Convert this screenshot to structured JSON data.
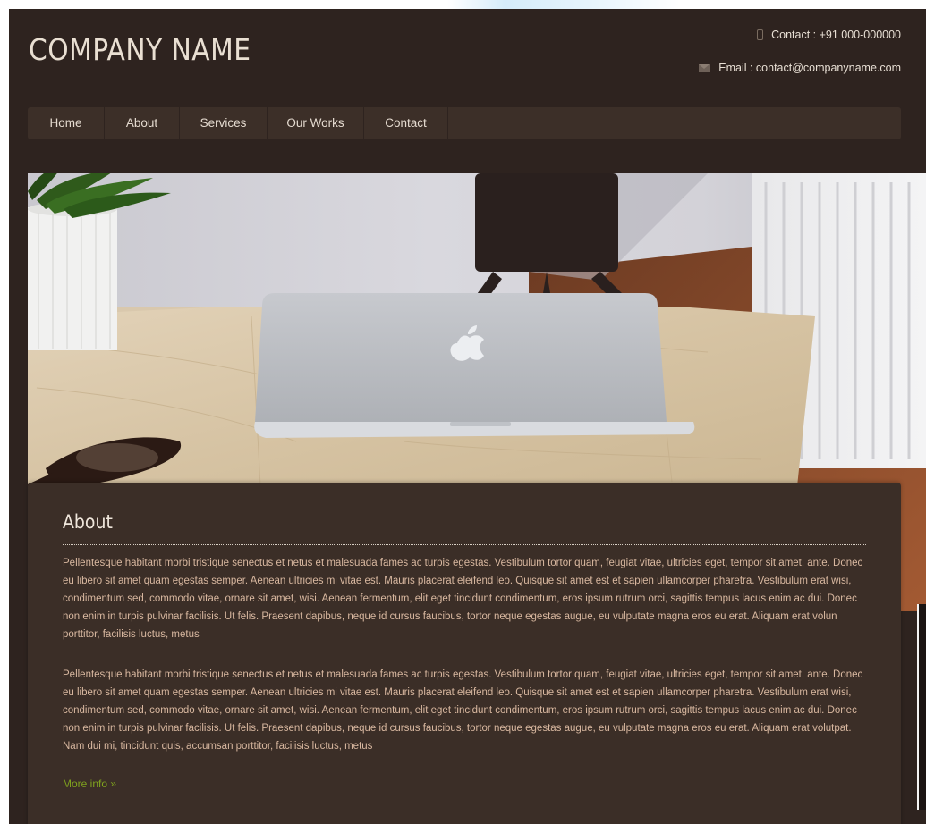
{
  "site": {
    "brand": "COMPANY NAME",
    "contact_phone": "Contact : +91 000-000000",
    "contact_email": "Email : contact@companyname.com"
  },
  "nav": {
    "items": [
      {
        "label": "Home"
      },
      {
        "label": "About"
      },
      {
        "label": "Services"
      },
      {
        "label": "Our Works"
      },
      {
        "label": "Contact"
      }
    ]
  },
  "hero": {
    "image": "laptop-on-wooden-desk-photo"
  },
  "about": {
    "title": "About",
    "paragraph_1": "Pellentesque habitant morbi tristique senectus et netus et malesuada fames ac turpis egestas. Vestibulum tortor quam, feugiat vitae, ultricies eget, tempor sit amet, ante. Donec eu libero sit amet quam egestas semper. Aenean ultricies mi vitae est. Mauris placerat eleifend leo. Quisque sit amet est et sapien ullamcorper pharetra. Vestibulum erat wisi, condimentum sed, commodo vitae, ornare sit amet, wisi. Aenean fermentum, elit eget tincidunt condimentum, eros ipsum rutrum orci, sagittis tempus lacus enim ac dui. Donec non enim in turpis pulvinar facilisis. Ut felis. Praesent dapibus, neque id cursus faucibus, tortor neque egestas augue, eu vulputate magna eros eu erat. Aliquam erat volun porttitor, facilisis luctus, metus",
    "paragraph_2": "Pellentesque habitant morbi tristique senectus et netus et malesuada fames ac turpis egestas. Vestibulum tortor quam, feugiat vitae, ultricies eget, tempor sit amet, ante. Donec eu libero sit amet quam egestas semper. Aenean ultricies mi vitae est. Mauris placerat eleifend leo. Quisque sit amet est et sapien ullamcorper pharetra. Vestibulum erat wisi, condimentum sed, commodo vitae, ornare sit amet, wisi. Aenean fermentum, elit eget tincidunt condimentum, eros ipsum rutrum orci, sagittis tempus lacus enim ac dui. Donec non enim in turpis pulvinar facilisis. Ut felis. Praesent dapibus, neque id cursus faucibus, tortor neque egestas augue, eu vulputate magna eros eu erat. Aliquam erat volutpat. Nam dui mi, tincidunt quis, accumsan porttitor, facilisis luctus, metus",
    "more_label": "More info »"
  },
  "colors": {
    "page_bg": "#2e231f",
    "panel_bg": "#3b2e27",
    "nav_bg": "#3c2f28",
    "body_text": "#d9b8a0",
    "link": "#7fa21e"
  },
  "icons": {
    "phone": "phone-icon",
    "email": "mail-icon"
  }
}
